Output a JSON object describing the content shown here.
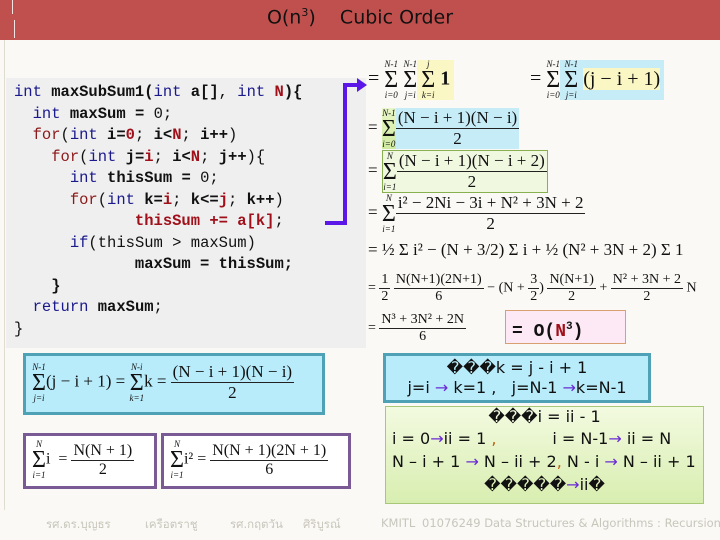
{
  "header": {
    "title_prefix": "O(n",
    "title_exp": "3",
    "title_suffix": ")    Cubic Order"
  },
  "code": {
    "lines": [
      "int maxSubSum1(int a[], int N){",
      "  int maxSum = 0;",
      "  for(int i=0; i<N; i++)",
      "    for(int j=i; i<N; j++){",
      "      int thisSum = 0;",
      "      for(int k=i; k<=j; k++)",
      "           thisSum += a[k];",
      "      if(thisSum > maxSum)",
      "           maxSum = thisSum;",
      "    }",
      "  return maxSum;",
      "}"
    ],
    "tokens": {
      "int": "int",
      "fn_name": "maxSubSum1",
      "param_a": "a[]",
      "param_n": "N",
      "for": "for",
      "if": "if",
      "return": "return",
      "maxSum": "maxSum",
      "thisSum": "thisSum",
      "zero": "0",
      "i": "i",
      "j": "j",
      "k": "k"
    }
  },
  "derivation": {
    "eq1_left": {
      "sums": [
        [
          "N-1",
          "i=0"
        ],
        [
          "N-1",
          "j=i"
        ],
        [
          "j",
          "k=i"
        ]
      ],
      "body": "1"
    },
    "eq1_right": {
      "sums": [
        [
          "N-1",
          "i=0"
        ],
        [
          "N-1",
          "j=i"
        ]
      ],
      "body": "(j − i + 1)"
    },
    "eq2": {
      "sum": [
        "N-1",
        "i=0"
      ],
      "num": "(N − i + 1)(N − i)",
      "den": "2"
    },
    "eq3": {
      "sum": [
        "N",
        "i=1"
      ],
      "num": "(N − i + 1)(N − i + 2)",
      "den": "2"
    },
    "eq4": {
      "sum": [
        "N",
        "i=1"
      ],
      "num": "i² − 2Ni − 3i + N² + 3N + 2",
      "den": "2"
    },
    "eq5": "= ½ Σ i² − (N + 3/2) Σ i + ½ (N² + 3N + 2) Σ 1",
    "eq6": {
      "t1_num": "N(N+1)(2N+1)",
      "t1_den": "6",
      "t2_num": "N(N+1)",
      "t2_den": "2",
      "t3_num": "N² + 3N + 2",
      "t3_den": "2",
      "half": "1",
      "half_den": "2",
      "three": "3",
      "three_den": "2"
    },
    "eq7": {
      "num": "N³ + 3N² + 2N",
      "den": "6"
    },
    "result": {
      "prefix": "= O(",
      "n": "N",
      "exp": "3",
      "suffix": ")"
    }
  },
  "identities": {
    "blue": {
      "left": "(j − i + 1) =",
      "sum1": [
        "N-1",
        "j=i"
      ],
      "sum2": [
        "N-i",
        "k=1"
      ],
      "mid": "k =",
      "num": "(N − i + 1)(N − i)",
      "den": "2"
    },
    "sum_i": {
      "sum": [
        "N",
        "i=1"
      ],
      "body": "i  =",
      "num": "N(N + 1)",
      "den": "2"
    },
    "sum_i2": {
      "sum": [
        "N",
        "i=1"
      ],
      "body": "i² =",
      "num": "N(N + 1)(2N + 1)",
      "den": "6"
    }
  },
  "notes": {
    "blue": {
      "line1_prefix": "���",
      "line1": "k = j - i + 1",
      "line2a": "j=i ",
      "line2b": " k=1 ,   j=N-1 ",
      "line2c": "k=N-1"
    },
    "green": {
      "line1_prefix": "���",
      "line1": "i = ii - 1",
      "line2a": "i = 0",
      "line2b": "ii = 1 ",
      "line2c": "           i = N-1",
      "line2d": " ii = N",
      "line3a": "N – i + 1 ",
      "line3b": " N – ii + 2",
      "line3c": " N - i ",
      "line3d": " N – ii + 1",
      "line4_prefix": "�����",
      "line4_mid": "ii",
      "line4_suffix": "�",
      "comma": ","
    },
    "arrow_glyph": "→"
  },
  "footer": {
    "author1": "รศ.ดร.บุญธร",
    "author2": "เครือตราชู",
    "author3": "รศ.กฤตวัน",
    "author4": "ศิริบูรณ์",
    "org": "KMITL",
    "course": "01076249 Data Structures & Algorithms : Recursion"
  }
}
